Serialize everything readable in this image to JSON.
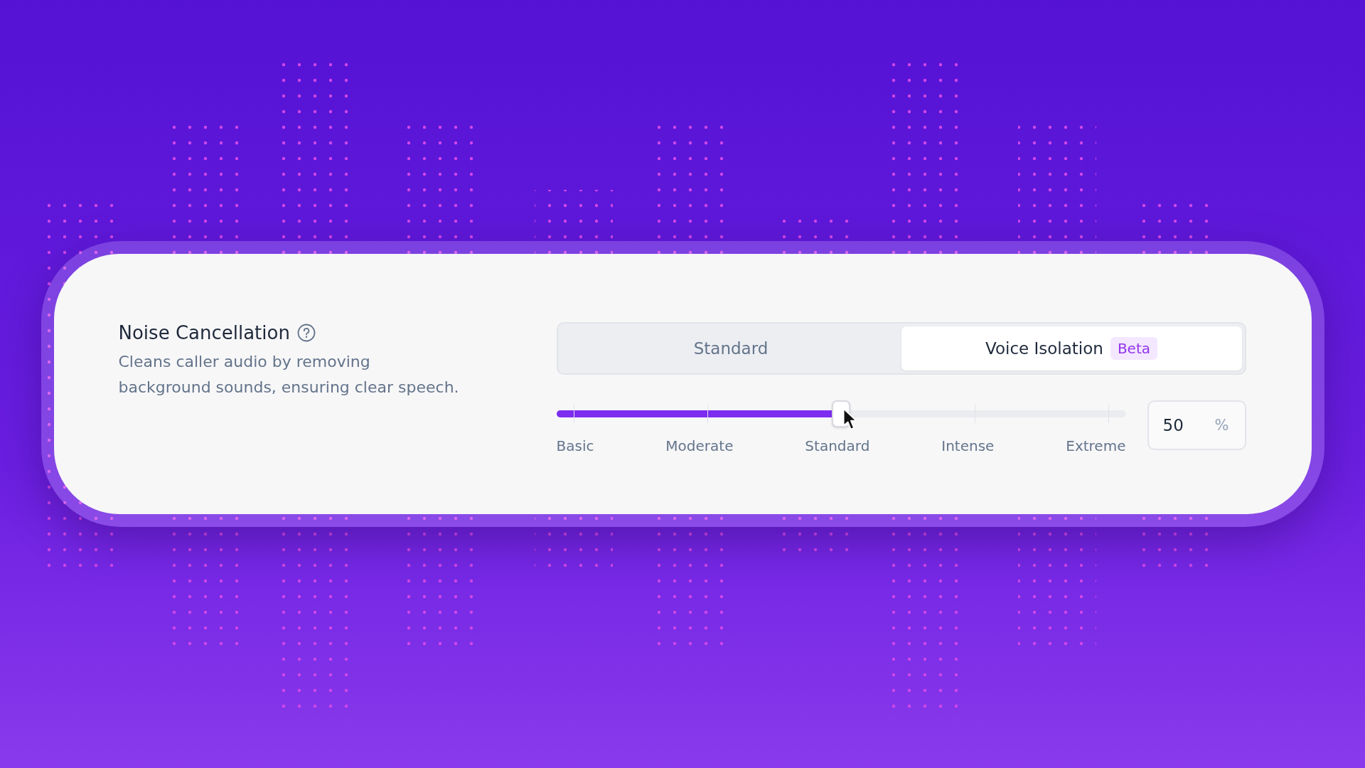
{
  "setting": {
    "title": "Noise Cancellation",
    "description": "Cleans caller audio by removing background sounds, ensuring clear speech."
  },
  "modes": [
    {
      "label": "Standard",
      "selected": false
    },
    {
      "label": "Voice Isolation",
      "selected": true,
      "badge": "Beta"
    }
  ],
  "slider": {
    "level": 0.5,
    "labels": [
      "Basic",
      "Moderate",
      "Standard",
      "Intense",
      "Extreme"
    ]
  },
  "value": {
    "text": "50",
    "unit": "%"
  }
}
